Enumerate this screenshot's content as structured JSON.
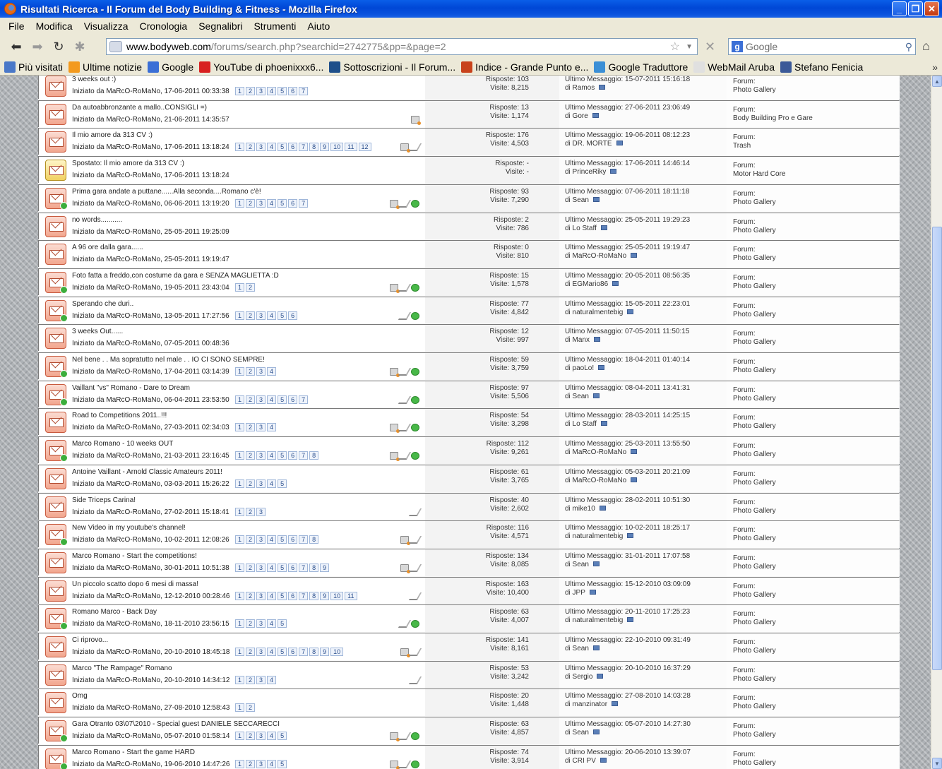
{
  "window": {
    "title": "Risultati Ricerca - Il Forum del Body Building & Fitness - Mozilla Firefox"
  },
  "menu": [
    "File",
    "Modifica",
    "Visualizza",
    "Cronologia",
    "Segnalibri",
    "Strumenti",
    "Aiuto"
  ],
  "urlbar": {
    "host": "www.bodyweb.com",
    "path": "/forums/search.php?searchid=2742775&pp=&page=2"
  },
  "search": {
    "placeholder": "Google"
  },
  "bookmarks": [
    {
      "label": "Più visitati",
      "color": "#4a78c8"
    },
    {
      "label": "Ultime notizie",
      "color": "#f39a1e"
    },
    {
      "label": "Google",
      "color": "#3b6fd6"
    },
    {
      "label": "YouTube di phoenixxx6...",
      "color": "#d82020"
    },
    {
      "label": "Sottoscrizioni - Il Forum...",
      "color": "#1e4f8a"
    },
    {
      "label": "Indice - Grande Punto e...",
      "color": "#c8421c"
    },
    {
      "label": "Google Traduttore",
      "color": "#3b8fd6"
    },
    {
      "label": "WebMail Aruba",
      "color": "#e0e0e0"
    },
    {
      "label": "Stefano Fenicia",
      "color": "#3b5998"
    }
  ],
  "threads": [
    {
      "title": "3 weeks out :)",
      "started": "Iniziato da MaRcO-RoMaNo, 17-06-2011 00:33:38",
      "pages": [
        "1",
        "2",
        "3",
        "4",
        "5",
        "6",
        "7"
      ],
      "replies": "Risposte: 103",
      "views": "Visite: 8,215",
      "last": "Ultimo Messaggio: 15-07-2011 15:16:18",
      "by": "di Ramos",
      "forum": "Photo Gallery",
      "icons": [],
      "dot": false,
      "moved": false
    },
    {
      "title": "Da autoabbronzante a mallo..CONSIGLI =)",
      "started": "Iniziato da MaRcO-RoMaNo, 21-06-2011 14:35:57",
      "pages": [],
      "replies": "Risposte: 13",
      "views": "Visite: 1,174",
      "last": "Ultimo Messaggio: 27-06-2011 23:06:49",
      "by": "di Gore",
      "forum": "Body Building Pro e Gare",
      "icons": [
        "att"
      ],
      "dot": false,
      "moved": false
    },
    {
      "title": "Il mio amore da 313 CV :)",
      "started": "Iniziato da MaRcO-RoMaNo, 17-06-2011 13:18:24",
      "pages": [
        "1",
        "2",
        "3",
        "4",
        "5",
        "6",
        "7",
        "8",
        "9",
        "10",
        "11",
        "12"
      ],
      "replies": "Risposte: 176",
      "views": "Visite: 4,503",
      "last": "Ultimo Messaggio: 19-06-2011 08:12:23",
      "by": "di DR. MORTE",
      "forum": "Trash",
      "icons": [
        "att",
        "pen"
      ],
      "dot": false,
      "moved": false
    },
    {
      "title": "Spostato: Il mio amore da 313 CV :)",
      "started": "Iniziato da MaRcO-RoMaNo, 17-06-2011 13:18:24",
      "pages": [],
      "replies": "Risposte: -",
      "views": "Visite: -",
      "last": "Ultimo Messaggio: 17-06-2011 14:46:14",
      "by": "di PrinceRiky",
      "forum": "Motor Hard Core",
      "icons": [],
      "dot": false,
      "moved": true
    },
    {
      "title": "Prima gara andate a puttane......Alla seconda....Romano c'è!",
      "started": "Iniziato da MaRcO-RoMaNo, 06-06-2011 13:19:20",
      "pages": [
        "1",
        "2",
        "3",
        "4",
        "5",
        "6",
        "7"
      ],
      "replies": "Risposte: 93",
      "views": "Visite: 7,290",
      "last": "Ultimo Messaggio: 07-06-2011 18:11:18",
      "by": "di Sean",
      "forum": "Photo Gallery",
      "icons": [
        "att",
        "pen",
        "ok"
      ],
      "dot": true,
      "moved": false
    },
    {
      "title": "no words...........",
      "started": "Iniziato da MaRcO-RoMaNo, 25-05-2011 19:25:09",
      "pages": [],
      "replies": "Risposte: 2",
      "views": "Visite: 786",
      "last": "Ultimo Messaggio: 25-05-2011 19:29:23",
      "by": "di Lo Staff",
      "forum": "Photo Gallery",
      "icons": [],
      "dot": false,
      "moved": false
    },
    {
      "title": "A 96 ore dalla gara......",
      "started": "Iniziato da MaRcO-RoMaNo, 25-05-2011 19:19:47",
      "pages": [],
      "replies": "Risposte: 0",
      "views": "Visite: 810",
      "last": "Ultimo Messaggio: 25-05-2011 19:19:47",
      "by": "di MaRcO-RoMaNo",
      "forum": "Photo Gallery",
      "icons": [],
      "dot": false,
      "moved": false
    },
    {
      "title": "Foto fatta a freddo,con costume da gara e SENZA MAGLIETTA :D",
      "started": "Iniziato da MaRcO-RoMaNo, 19-05-2011 23:43:04",
      "pages": [
        "1",
        "2"
      ],
      "replies": "Risposte: 15",
      "views": "Visite: 1,578",
      "last": "Ultimo Messaggio: 20-05-2011 08:56:35",
      "by": "di EGMario86",
      "forum": "Photo Gallery",
      "icons": [
        "att",
        "pen",
        "ok"
      ],
      "dot": true,
      "moved": false
    },
    {
      "title": "Sperando che duri..",
      "started": "Iniziato da MaRcO-RoMaNo, 13-05-2011 17:27:56",
      "pages": [
        "1",
        "2",
        "3",
        "4",
        "5",
        "6"
      ],
      "replies": "Risposte: 77",
      "views": "Visite: 4,842",
      "last": "Ultimo Messaggio: 15-05-2011 22:23:01",
      "by": "di naturalmentebig",
      "forum": "Photo Gallery",
      "icons": [
        "pen",
        "ok"
      ],
      "dot": true,
      "moved": false
    },
    {
      "title": "3 weeks Out......",
      "started": "Iniziato da MaRcO-RoMaNo, 07-05-2011 00:48:36",
      "pages": [],
      "replies": "Risposte: 12",
      "views": "Visite: 997",
      "last": "Ultimo Messaggio: 07-05-2011 11:50:15",
      "by": "di Manx",
      "forum": "Photo Gallery",
      "icons": [],
      "dot": false,
      "moved": false
    },
    {
      "title": "Nel bene . . Ma sopratutto nel male . . IO CI SONO SEMPRE!",
      "started": "Iniziato da MaRcO-RoMaNo, 17-04-2011 03:14:39",
      "pages": [
        "1",
        "2",
        "3",
        "4"
      ],
      "replies": "Risposte: 59",
      "views": "Visite: 3,759",
      "last": "Ultimo Messaggio: 18-04-2011 01:40:14",
      "by": "di paoLo!",
      "forum": "Photo Gallery",
      "icons": [
        "att",
        "pen",
        "ok"
      ],
      "dot": true,
      "moved": false
    },
    {
      "title": "Vaillant \"vs\" Romano - Dare to Dream",
      "started": "Iniziato da MaRcO-RoMaNo, 06-04-2011 23:53:50",
      "pages": [
        "1",
        "2",
        "3",
        "4",
        "5",
        "6",
        "7"
      ],
      "replies": "Risposte: 97",
      "views": "Visite: 5,506",
      "last": "Ultimo Messaggio: 08-04-2011 13:41:31",
      "by": "di Sean",
      "forum": "Photo Gallery",
      "icons": [
        "pen",
        "ok"
      ],
      "dot": true,
      "moved": false
    },
    {
      "title": "Road to Competitions 2011..!!!",
      "started": "Iniziato da MaRcO-RoMaNo, 27-03-2011 02:34:03",
      "pages": [
        "1",
        "2",
        "3",
        "4"
      ],
      "replies": "Risposte: 54",
      "views": "Visite: 3,298",
      "last": "Ultimo Messaggio: 28-03-2011 14:25:15",
      "by": "di Lo Staff",
      "forum": "Photo Gallery",
      "icons": [
        "att",
        "pen",
        "ok"
      ],
      "dot": false,
      "moved": false
    },
    {
      "title": "Marco Romano - 10 weeks OUT",
      "started": "Iniziato da MaRcO-RoMaNo, 21-03-2011 23:16:45",
      "pages": [
        "1",
        "2",
        "3",
        "4",
        "5",
        "6",
        "7",
        "8"
      ],
      "replies": "Risposte: 112",
      "views": "Visite: 9,261",
      "last": "Ultimo Messaggio: 25-03-2011 13:55:50",
      "by": "di MaRcO-RoMaNo",
      "forum": "Photo Gallery",
      "icons": [
        "att",
        "pen",
        "ok"
      ],
      "dot": true,
      "moved": false
    },
    {
      "title": "Antoine Vaillant - Arnold Classic Amateurs 2011!",
      "started": "Iniziato da MaRcO-RoMaNo, 03-03-2011 15:26:22",
      "pages": [
        "1",
        "2",
        "3",
        "4",
        "5"
      ],
      "replies": "Risposte: 61",
      "views": "Visite: 3,765",
      "last": "Ultimo Messaggio: 05-03-2011 20:21:09",
      "by": "di MaRcO-RoMaNo",
      "forum": "Photo Gallery",
      "icons": [],
      "dot": false,
      "moved": false
    },
    {
      "title": "Side Triceps Carina!",
      "started": "Iniziato da MaRcO-RoMaNo, 27-02-2011 15:18:41",
      "pages": [
        "1",
        "2",
        "3"
      ],
      "replies": "Risposte: 40",
      "views": "Visite: 2,602",
      "last": "Ultimo Messaggio: 28-02-2011 10:51:30",
      "by": "di mike10",
      "forum": "Photo Gallery",
      "icons": [
        "pen"
      ],
      "dot": false,
      "moved": false
    },
    {
      "title": "New Video in my youtube's channel!",
      "started": "Iniziato da MaRcO-RoMaNo, 10-02-2011 12:08:26",
      "pages": [
        "1",
        "2",
        "3",
        "4",
        "5",
        "6",
        "7",
        "8"
      ],
      "replies": "Risposte: 116",
      "views": "Visite: 4,571",
      "last": "Ultimo Messaggio: 10-02-2011 18:25:17",
      "by": "di naturalmentebig",
      "forum": "Photo Gallery",
      "icons": [
        "att",
        "pen"
      ],
      "dot": true,
      "moved": false
    },
    {
      "title": "Marco Romano - Start the competitions!",
      "started": "Iniziato da MaRcO-RoMaNo, 30-01-2011 10:51:38",
      "pages": [
        "1",
        "2",
        "3",
        "4",
        "5",
        "6",
        "7",
        "8",
        "9"
      ],
      "replies": "Risposte: 134",
      "views": "Visite: 8,085",
      "last": "Ultimo Messaggio: 31-01-2011 17:07:58",
      "by": "di Sean",
      "forum": "Photo Gallery",
      "icons": [
        "att",
        "pen"
      ],
      "dot": false,
      "moved": false
    },
    {
      "title": "Un piccolo scatto dopo 6 mesi di massa!",
      "started": "Iniziato da MaRcO-RoMaNo, 12-12-2010 00:28:46",
      "pages": [
        "1",
        "2",
        "3",
        "4",
        "5",
        "6",
        "7",
        "8",
        "9",
        "10",
        "11"
      ],
      "replies": "Risposte: 163",
      "views": "Visite: 10,400",
      "last": "Ultimo Messaggio: 15-12-2010 03:09:09",
      "by": "di JPP",
      "forum": "Photo Gallery",
      "icons": [
        "pen"
      ],
      "dot": false,
      "moved": false
    },
    {
      "title": "Romano Marco - Back Day",
      "started": "Iniziato da MaRcO-RoMaNo, 18-11-2010 23:56:15",
      "pages": [
        "1",
        "2",
        "3",
        "4",
        "5"
      ],
      "replies": "Risposte: 63",
      "views": "Visite: 4,007",
      "last": "Ultimo Messaggio: 20-11-2010 17:25:23",
      "by": "di naturalmentebig",
      "forum": "Photo Gallery",
      "icons": [
        "pen",
        "ok"
      ],
      "dot": true,
      "moved": false
    },
    {
      "title": "Ci riprovo...",
      "started": "Iniziato da MaRcO-RoMaNo, 20-10-2010 18:45:18",
      "pages": [
        "1",
        "2",
        "3",
        "4",
        "5",
        "6",
        "7",
        "8",
        "9",
        "10"
      ],
      "replies": "Risposte: 141",
      "views": "Visite: 8,161",
      "last": "Ultimo Messaggio: 22-10-2010 09:31:49",
      "by": "di Sean",
      "forum": "Photo Gallery",
      "icons": [
        "att",
        "pen"
      ],
      "dot": false,
      "moved": false
    },
    {
      "title": "Marco \"The Rampage\" Romano",
      "started": "Iniziato da MaRcO-RoMaNo, 20-10-2010 14:34:12",
      "pages": [
        "1",
        "2",
        "3",
        "4"
      ],
      "replies": "Risposte: 53",
      "views": "Visite: 3,242",
      "last": "Ultimo Messaggio: 20-10-2010 16:37:29",
      "by": "di Sergio",
      "forum": "Photo Gallery",
      "icons": [
        "pen"
      ],
      "dot": false,
      "moved": false
    },
    {
      "title": "Omg",
      "started": "Iniziato da MaRcO-RoMaNo, 27-08-2010 12:58:43",
      "pages": [
        "1",
        "2"
      ],
      "replies": "Risposte: 20",
      "views": "Visite: 1,448",
      "last": "Ultimo Messaggio: 27-08-2010 14:03:28",
      "by": "di manzinator",
      "forum": "Photo Gallery",
      "icons": [],
      "dot": false,
      "moved": false
    },
    {
      "title": "Gara Otranto 03\\07\\2010 - Special guest DANIELE SECCARECCI",
      "started": "Iniziato da MaRcO-RoMaNo, 05-07-2010 01:58:14",
      "pages": [
        "1",
        "2",
        "3",
        "4",
        "5"
      ],
      "replies": "Risposte: 63",
      "views": "Visite: 4,857",
      "last": "Ultimo Messaggio: 05-07-2010 14:27:30",
      "by": "di Sean",
      "forum": "Photo Gallery",
      "icons": [
        "att",
        "pen",
        "ok"
      ],
      "dot": true,
      "moved": false
    },
    {
      "title": "Marco Romano - Start the game HARD",
      "started": "Iniziato da MaRcO-RoMaNo, 19-06-2010 14:47:26",
      "pages": [
        "1",
        "2",
        "3",
        "4",
        "5"
      ],
      "replies": "Risposte: 74",
      "views": "Visite: 3,914",
      "last": "Ultimo Messaggio: 20-06-2010 13:39:07",
      "by": "di CRI PV",
      "forum": "Photo Gallery",
      "icons": [
        "att",
        "pen",
        "ok"
      ],
      "dot": true,
      "moved": false
    }
  ],
  "labels": {
    "forum": "Forum:"
  }
}
